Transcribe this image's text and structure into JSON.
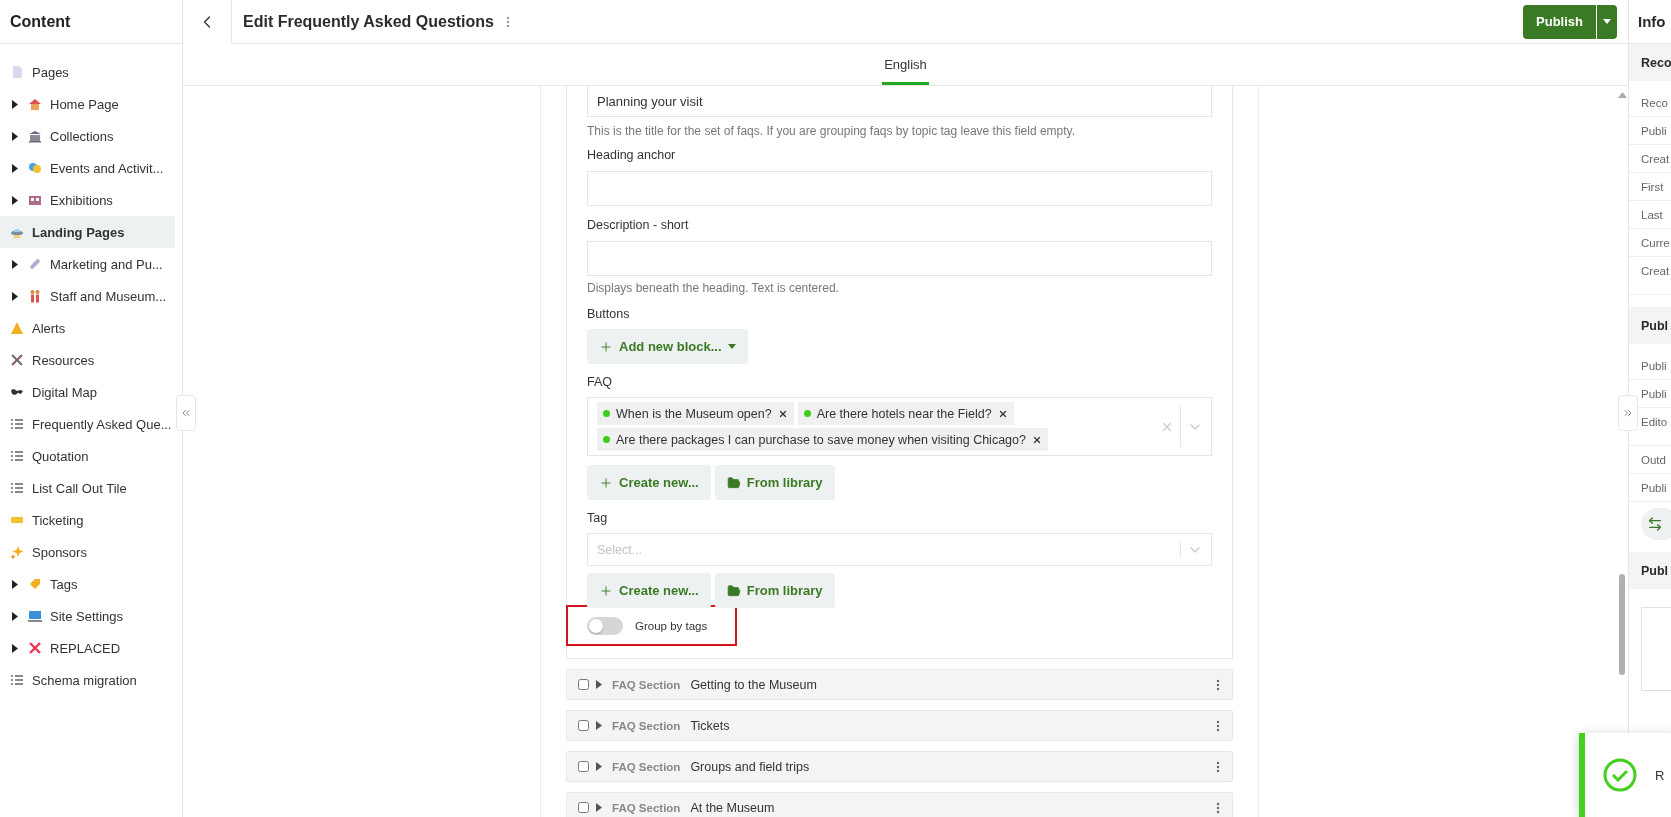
{
  "sidebar": {
    "title": "Content",
    "items": [
      {
        "label": "Pages",
        "expandable": false,
        "selected": false
      },
      {
        "label": "Home Page",
        "expandable": true,
        "selected": false
      },
      {
        "label": "Collections",
        "expandable": true,
        "selected": false
      },
      {
        "label": "Events and Activit...",
        "expandable": true,
        "selected": false
      },
      {
        "label": "Exhibitions",
        "expandable": true,
        "selected": false
      },
      {
        "label": "Landing Pages",
        "expandable": false,
        "selected": true
      },
      {
        "label": "Marketing and Pu...",
        "expandable": true,
        "selected": false
      },
      {
        "label": "Staff and Museum...",
        "expandable": true,
        "selected": false
      },
      {
        "label": "Alerts",
        "expandable": false,
        "selected": false
      },
      {
        "label": "Resources",
        "expandable": false,
        "selected": false
      },
      {
        "label": "Digital Map",
        "expandable": false,
        "selected": false
      },
      {
        "label": "Frequently Asked Que...",
        "expandable": false,
        "selected": false
      },
      {
        "label": "Quotation",
        "expandable": false,
        "selected": false
      },
      {
        "label": "List Call Out Tile",
        "expandable": false,
        "selected": false
      },
      {
        "label": "Ticketing",
        "expandable": false,
        "selected": false
      },
      {
        "label": "Sponsors",
        "expandable": false,
        "selected": false
      },
      {
        "label": "Tags",
        "expandable": true,
        "selected": false
      },
      {
        "label": "Site Settings",
        "expandable": true,
        "selected": false
      },
      {
        "label": "REPLACED",
        "expandable": true,
        "selected": false
      },
      {
        "label": "Schema migration",
        "expandable": false,
        "selected": false
      }
    ]
  },
  "header": {
    "title": "Edit Frequently Asked Questions",
    "publish": "Publish"
  },
  "tabs": [
    {
      "label": "English",
      "selected": true
    }
  ],
  "form": {
    "title_value": "Planning your visit",
    "title_hint": "This is the title for the set of faqs. If you are grouping faqs by topic tag leave this field empty.",
    "heading_anchor_label": "Heading anchor",
    "description_label": "Description - short",
    "description_hint": "Displays beneath the heading. Text is centered.",
    "buttons_label": "Buttons",
    "add_block": "Add new block...",
    "faq_label": "FAQ",
    "faq_items": [
      "When is the Museum open?",
      "Are there hotels near the Field?",
      "Are there packages I can purchase to save money when visiting Chicago?"
    ],
    "create_new": "Create new...",
    "from_library": "From library",
    "tag_label": "Tag",
    "tag_placeholder": "Select...",
    "create_new_2": "Create new...",
    "from_library_2": "From library",
    "group_by_tags": {
      "label": "Group by tags",
      "on": false
    }
  },
  "sections": [
    {
      "type": "FAQ Section",
      "title": "Getting to the Museum",
      "checked": false
    },
    {
      "type": "FAQ Section",
      "title": "Tickets",
      "checked": false
    },
    {
      "type": "FAQ Section",
      "title": "Groups and field trips",
      "checked": false
    },
    {
      "type": "FAQ Section",
      "title": "At the Museum",
      "checked": false
    }
  ],
  "info_panel": {
    "title": "Info",
    "sections": [
      {
        "kind": "rows",
        "title": "Reco",
        "rows": [
          {
            "label": "Reco",
            "kind": "line"
          },
          {
            "label": "Publi",
            "kind": "line"
          },
          {
            "label": "Creat",
            "kind": "line"
          },
          {
            "label": "First",
            "kind": "line"
          },
          {
            "label": "Last",
            "kind": "line"
          },
          {
            "label": "Curre",
            "kind": "line"
          },
          {
            "label": "Creat",
            "kind": "tall"
          }
        ]
      },
      {
        "kind": "rows",
        "title": "Publ",
        "swap_button": true,
        "rows": [
          {
            "label": "Publi",
            "kind": "line"
          },
          {
            "label": "Publi",
            "kind": "line"
          },
          {
            "label": "Edito",
            "kind": "tall"
          },
          {
            "label": "Outd",
            "kind": "line"
          },
          {
            "label": "Publi",
            "kind": "line"
          }
        ]
      },
      {
        "kind": "box",
        "title": "Publ"
      }
    ]
  },
  "toast": {
    "text": "R"
  }
}
